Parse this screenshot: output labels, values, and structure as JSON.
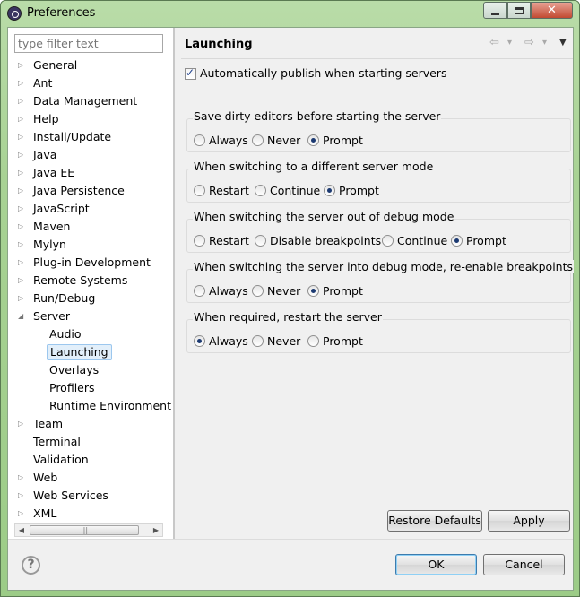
{
  "window": {
    "title": "Preferences",
    "close_glyph": "✕"
  },
  "sidebar": {
    "filter_placeholder": "type filter text",
    "items": [
      {
        "label": "General",
        "level": 0,
        "expandable": true,
        "expanded": false
      },
      {
        "label": "Ant",
        "level": 0,
        "expandable": true,
        "expanded": false
      },
      {
        "label": "Data Management",
        "level": 0,
        "expandable": true,
        "expanded": false
      },
      {
        "label": "Help",
        "level": 0,
        "expandable": true,
        "expanded": false
      },
      {
        "label": "Install/Update",
        "level": 0,
        "expandable": true,
        "expanded": false
      },
      {
        "label": "Java",
        "level": 0,
        "expandable": true,
        "expanded": false
      },
      {
        "label": "Java EE",
        "level": 0,
        "expandable": true,
        "expanded": false
      },
      {
        "label": "Java Persistence",
        "level": 0,
        "expandable": true,
        "expanded": false
      },
      {
        "label": "JavaScript",
        "level": 0,
        "expandable": true,
        "expanded": false
      },
      {
        "label": "Maven",
        "level": 0,
        "expandable": true,
        "expanded": false
      },
      {
        "label": "Mylyn",
        "level": 0,
        "expandable": true,
        "expanded": false
      },
      {
        "label": "Plug-in Development",
        "level": 0,
        "expandable": true,
        "expanded": false
      },
      {
        "label": "Remote Systems",
        "level": 0,
        "expandable": true,
        "expanded": false
      },
      {
        "label": "Run/Debug",
        "level": 0,
        "expandable": true,
        "expanded": false
      },
      {
        "label": "Server",
        "level": 0,
        "expandable": true,
        "expanded": true
      },
      {
        "label": "Audio",
        "level": 1,
        "expandable": false
      },
      {
        "label": "Launching",
        "level": 1,
        "expandable": false,
        "selected": true
      },
      {
        "label": "Overlays",
        "level": 1,
        "expandable": false
      },
      {
        "label": "Profilers",
        "level": 1,
        "expandable": false
      },
      {
        "label": "Runtime Environment",
        "level": 1,
        "expandable": false
      },
      {
        "label": "Team",
        "level": 0,
        "expandable": true,
        "expanded": false
      },
      {
        "label": "Terminal",
        "level": 0,
        "expandable": false
      },
      {
        "label": "Validation",
        "level": 0,
        "expandable": false
      },
      {
        "label": "Web",
        "level": 0,
        "expandable": true,
        "expanded": false
      },
      {
        "label": "Web Services",
        "level": 0,
        "expandable": true,
        "expanded": false
      },
      {
        "label": "XML",
        "level": 0,
        "expandable": true,
        "expanded": false
      }
    ],
    "scrollbar": {
      "left_arrow": "◀",
      "right_arrow": "▶",
      "grip": "|||"
    }
  },
  "page": {
    "title": "Launching",
    "nav": {
      "back": "⇦",
      "forward": "⇨",
      "dropdown": "▾",
      "menu": "▼"
    },
    "auto_publish_label": "Automatically publish when starting servers",
    "auto_publish_checked": true,
    "groups": [
      {
        "title": "Save dirty editors before starting the server",
        "options": [
          {
            "label": "Always",
            "selected": false
          },
          {
            "label": "Never",
            "selected": false
          },
          {
            "label": "Prompt",
            "selected": true
          }
        ]
      },
      {
        "title": "When switching to a different server mode",
        "options": [
          {
            "label": "Restart",
            "selected": false
          },
          {
            "label": "Continue",
            "selected": false
          },
          {
            "label": "Prompt",
            "selected": true
          }
        ]
      },
      {
        "title": "When switching the server out of debug mode",
        "options": [
          {
            "label": "Restart",
            "selected": false
          },
          {
            "label": "Disable breakpoints",
            "selected": false
          },
          {
            "label": "Continue",
            "selected": false
          },
          {
            "label": "Prompt",
            "selected": true
          }
        ]
      },
      {
        "title": "When switching the server into debug mode, re-enable breakpoints",
        "options": [
          {
            "label": "Always",
            "selected": false
          },
          {
            "label": "Never",
            "selected": false
          },
          {
            "label": "Prompt",
            "selected": true
          }
        ]
      },
      {
        "title": "When required, restart the server",
        "options": [
          {
            "label": "Always",
            "selected": true
          },
          {
            "label": "Never",
            "selected": false
          },
          {
            "label": "Prompt",
            "selected": false
          }
        ]
      }
    ],
    "restore_defaults_label": "Restore Defaults",
    "apply_label": "Apply"
  },
  "footer": {
    "help_glyph": "?",
    "ok_label": "OK",
    "cancel_label": "Cancel"
  }
}
